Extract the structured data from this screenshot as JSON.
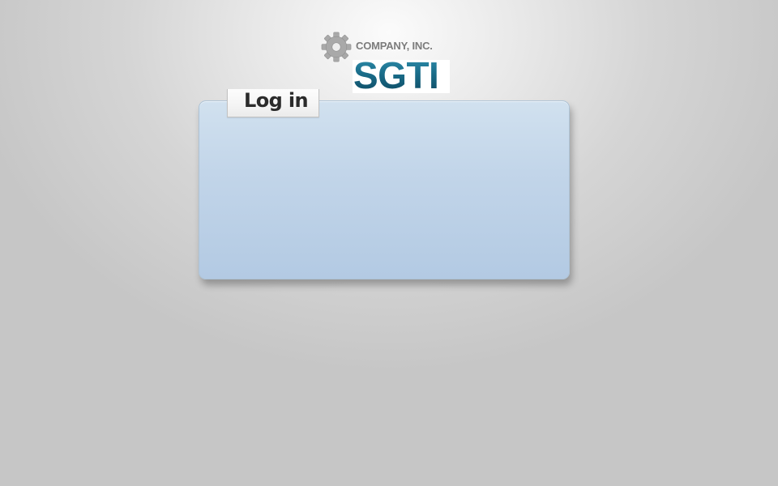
{
  "logo": {
    "company_name": "COMPANY, INC.",
    "brand": "SGTI",
    "icon": "gear-icon"
  },
  "login": {
    "title": "Log in"
  },
  "colors": {
    "panel_top": "#d1e1ef",
    "panel_bottom": "#b3cae3",
    "brand_teal": "#1b6580",
    "background_light": "#fbfbfb",
    "background_dark": "#c6c6c6"
  }
}
